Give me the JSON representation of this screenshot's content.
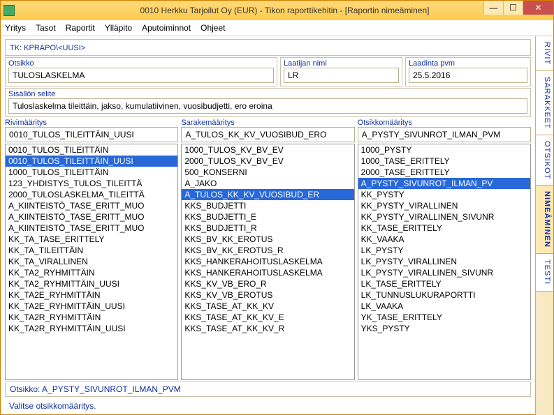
{
  "window": {
    "title": "0010  Herkku Tarjoilut Oy (EUR) - Tikon raporttikehitin - [Raportin nimeäminen]"
  },
  "menu": {
    "items": [
      "Yritys",
      "Tasot",
      "Raportit",
      "Ylläpito",
      "Aputoiminnot",
      "Ohjeet"
    ]
  },
  "path": "TK: KPRAPO\\<UUSI>",
  "fields": {
    "otsikko_label": "Otsikko",
    "otsikko_value": "TULOSLASKELMA",
    "laatija_label": "Laatijan nimi",
    "laatija_value": "LR",
    "pvm_label": "Laadinta pvm",
    "pvm_value": "25.5.2016",
    "selite_label": "Sisällön selite",
    "selite_value": "Tuloslaskelma tileittäin, jakso, kumulatiivinen, vuosibudjetti, ero eroina"
  },
  "columns": {
    "rivi": {
      "label": "Rivimääritys",
      "value": "0010_TULOS_TILEITTÄIN_UUSI",
      "selected": "0010_TULOS_TILEITTÄIN_UUSI",
      "items": [
        "0010_TULOS_TILEITTÄIN",
        "0010_TULOS_TILEITTÄIN_UUSI",
        "1000_TULOS_TILEITTÄIN",
        "123_YHDISTYS_TULOS_TILEITTÄ",
        "2000_TULOSLASKELMA_TILEITTÄ",
        "A_KIINTEISTÖ_TASE_ERITT_MUO",
        "A_KIINTEISTÖ_TASE_ERITT_MUO",
        "A_KIINTEISTÖ_TASE_ERITT_MUO",
        "KK_TA_TASE_ERITTELY",
        "KK_TA_TILEITTÄIN",
        "KK_TA_VIRALLINEN",
        "KK_TA2_RYHMITTÄIN",
        "KK_TA2_RYHMITTÄIN_UUSI",
        "KK_TA2E_RYHMITTÄIN",
        "KK_TA2E_RYHMITTÄIN_UUSI",
        "KK_TA2R_RYHMITTÄIN",
        "KK_TA2R_RYHMITTÄIN_UUSI"
      ]
    },
    "sarake": {
      "label": "Sarakemääritys",
      "value": "A_TULOS_KK_KV_VUOSIBUD_ERO",
      "selected": "A_TULOS_KK_KV_VUOSIBUD_ER",
      "items": [
        "1000_TULOS_KV_BV_EV",
        "2000_TULOS_KV_BV_EV",
        "500_KONSERNI",
        "A_JAKO",
        "A_TULOS_KK_KV_VUOSIBUD_ER",
        "KKS_BUDJETTI",
        "KKS_BUDJETTI_E",
        "KKS_BUDJETTI_R",
        "KKS_BV_KK_EROTUS",
        "KKS_BV_KK_EROTUS_R",
        "KKS_HANKERAHOITUSLASKELMA",
        "KKS_HANKERAHOITUSLASKELMA",
        "KKS_KV_VB_ERO_R",
        "KKS_KV_VB_EROTUS",
        "KKS_TASE_AT_KK_KV",
        "KKS_TASE_AT_KK_KV_E",
        "KKS_TASE_AT_KK_KV_R"
      ]
    },
    "otsikko": {
      "label": "Otsikkomääritys",
      "value": "A_PYSTY_SIVUNROT_ILMAN_PVM",
      "selected": "A_PYSTY_SIVUNROT_ILMAN_PV",
      "items": [
        "1000_PYSTY",
        "1000_TASE_ERITTELY",
        "2000_TASE_ERITTELY",
        "A_PYSTY_SIVUNROT_ILMAN_PV",
        "KK_PYSTY",
        "KK_PYSTY_VIRALLINEN",
        "KK_PYSTY_VIRALLINEN_SIVUNR",
        "KK_TASE_ERITTELY",
        "KK_VAAKA",
        "LK_PYSTY",
        "LK_PYSTY_VIRALLINEN",
        "LK_PYSTY_VIRALLINEN_SIVUNR",
        "LK_TASE_ERITTELY",
        "LK_TUNNUSLUKURAPORTTI",
        "LK_VAAKA",
        "YK_TASE_ERITTELY",
        "YKS_PYSTY"
      ]
    }
  },
  "status": {
    "line": "Otsikko: A_PYSTY_SIVUNROT_ILMAN_PVM",
    "hint": "Valitse otsikkomääritys."
  },
  "side_tabs": [
    "RIVIT",
    "SARAKKEET",
    "OTSIKOT",
    "NIMEÄMINEN",
    "TESTI"
  ],
  "side_active": "NIMEÄMINEN"
}
